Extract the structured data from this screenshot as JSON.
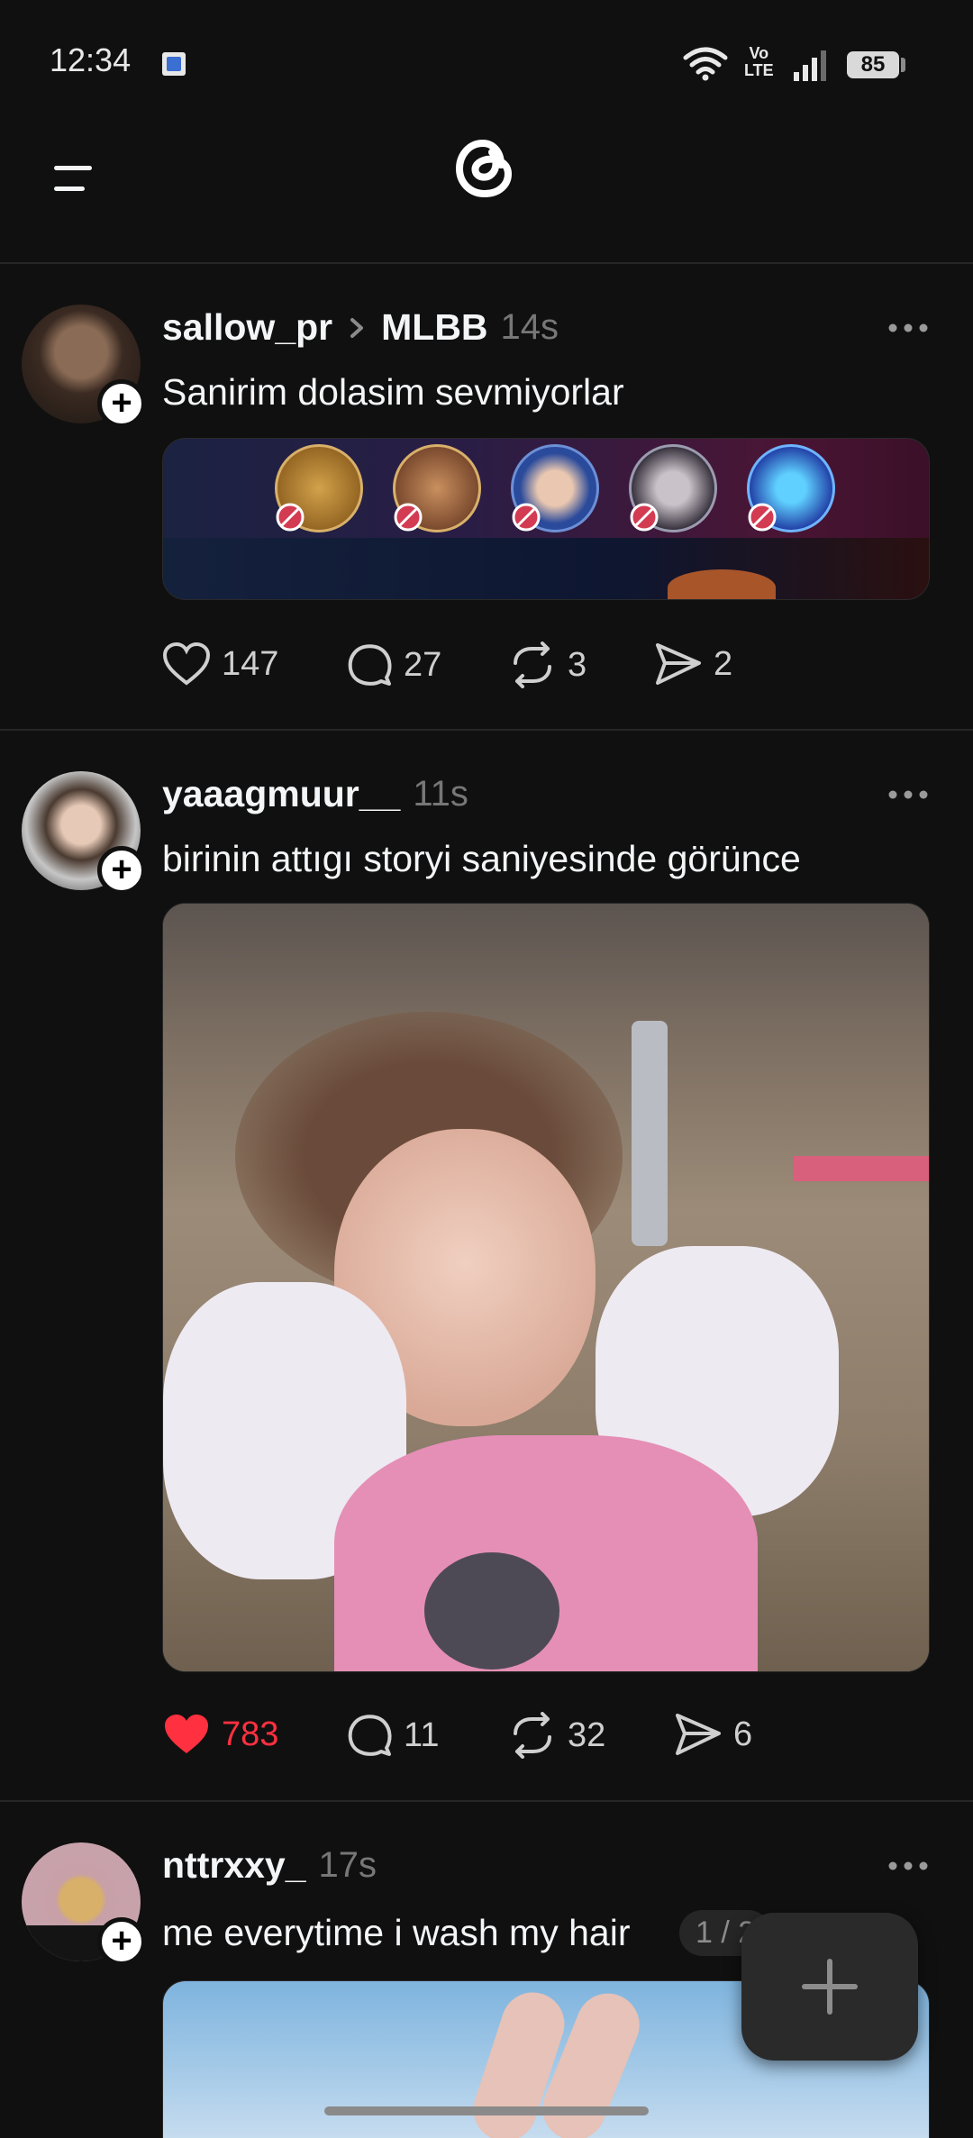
{
  "status_bar": {
    "time": "12:34",
    "volte_line1": "Vo",
    "volte_line2": "LTE",
    "battery": "85"
  },
  "header": {
    "menu_icon": "menu-icon",
    "logo_icon": "threads-logo-icon"
  },
  "posts": [
    {
      "username": "sallow_pr",
      "community": "MLBB",
      "time": "14s",
      "text": "Sanirim dolasim sevmiyorlar",
      "media": "banned-heroes-banner",
      "likes": "147",
      "comments": "27",
      "reposts": "3",
      "shares": "2",
      "liked": false
    },
    {
      "username": "yaaagmuur__",
      "time": "11s",
      "text": "birinin attıgı storyi saniyesinde görünce",
      "media": "toddler-photo",
      "likes": "783",
      "comments": "11",
      "reposts": "32",
      "shares": "6",
      "liked": true
    },
    {
      "username": "nttrxxy_",
      "time": "17s",
      "text": "me everytime i wash my hair",
      "page_indicator": "1 / 2",
      "media": "anime-hands-photo"
    }
  ],
  "colors": {
    "background": "#101010",
    "like_red": "#ff3040",
    "muted": "#777777"
  }
}
